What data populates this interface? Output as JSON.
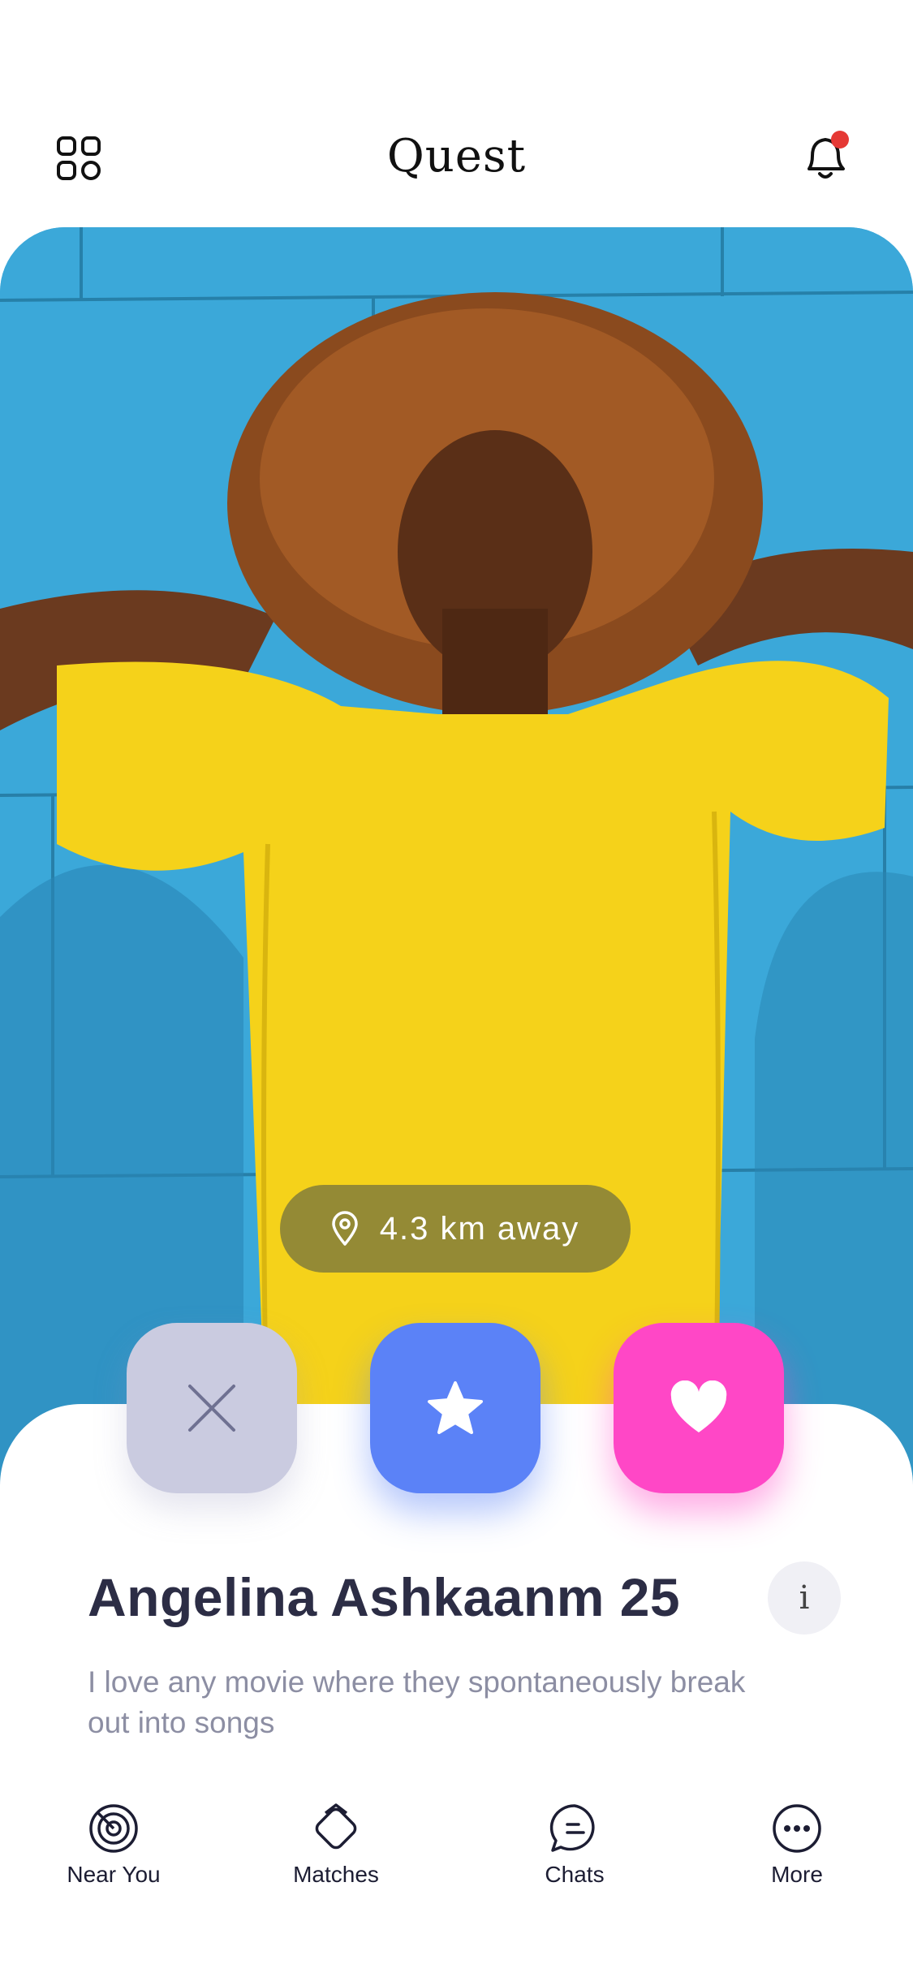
{
  "header": {
    "title": "Quest"
  },
  "card": {
    "distance": "4.3  km  away"
  },
  "profile": {
    "name": "Angelina Ashkaanm 25",
    "bio": "I love any movie where they spontaneously break out into songs",
    "info_label": "i"
  },
  "actions": [
    {
      "name": "dislike",
      "icon": "close-icon",
      "color": "#cacbe0"
    },
    {
      "name": "super-like",
      "icon": "star-icon",
      "color": "#5b82f7"
    },
    {
      "name": "like",
      "icon": "heart-icon",
      "color": "#ff47c6"
    }
  ],
  "tabs": [
    {
      "label": "Near You",
      "icon": "radar-icon"
    },
    {
      "label": "Matches",
      "icon": "diamond-icon"
    },
    {
      "label": "Chats",
      "icon": "chat-icon"
    },
    {
      "label": "More",
      "icon": "more-icon"
    }
  ],
  "colors": {
    "notification_dot": "#e53935",
    "photo_background": "#3ba8d9",
    "shirt": "#f5d21a"
  }
}
